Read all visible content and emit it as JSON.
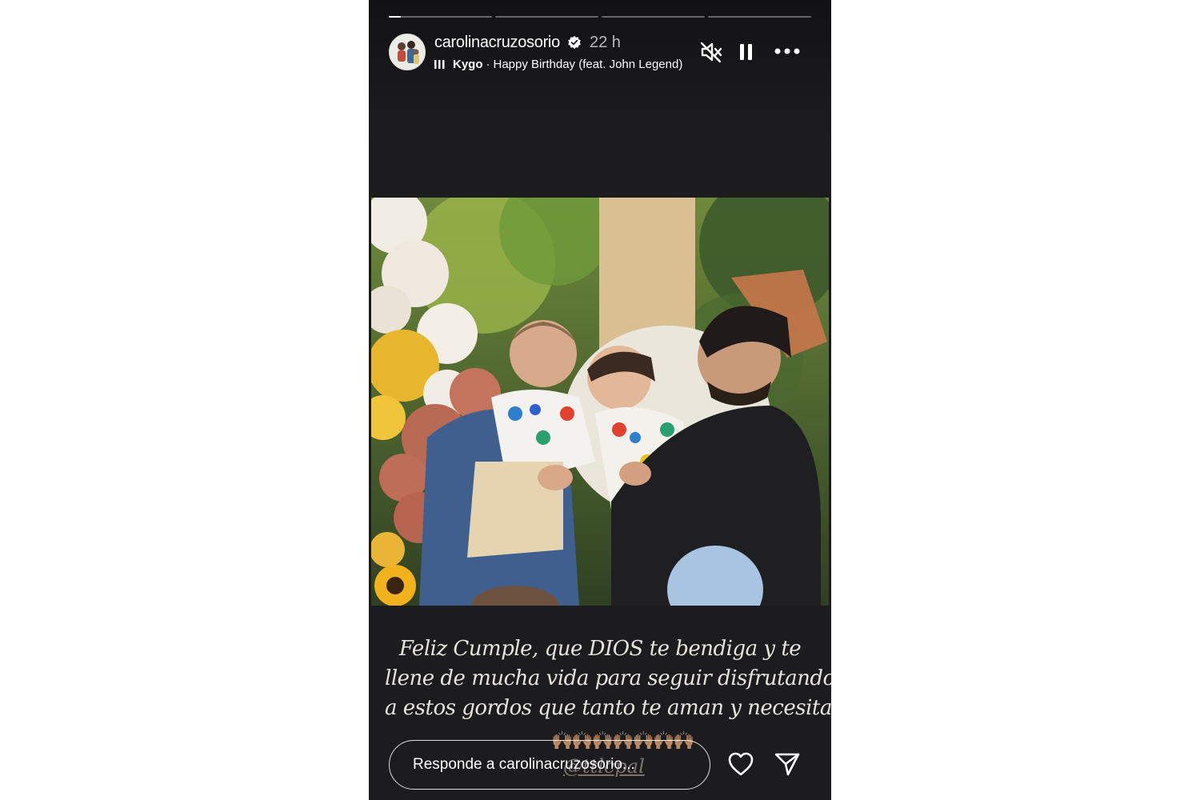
{
  "story": {
    "username": "carolinacruzosorio",
    "time": "22 h",
    "music": {
      "artist": "Kygo",
      "separator": "·",
      "song": "Happy Birthday (feat. John Legend)"
    },
    "progress": [
      0.12,
      0,
      0,
      0
    ],
    "icons": {
      "mute": "muted-speaker-icon",
      "pause": "pause-icon",
      "more": "more-options-icon",
      "verified": "verified-badge-icon",
      "like": "heart-icon",
      "share": "send-icon"
    },
    "caption_lines": [
      "Feliz Cumple, que DIOS te  bendiga y te",
      "llene de mucha vida para seguir disfrutando",
      "a estos gordos que tanto te aman y necesitan"
    ],
    "emoji": "🙌🏽🙌🏽🙌🏽🙌🏽🙌🏽🙌🏽🙌🏽",
    "mention": "@ttlcpal",
    "reply_placeholder": "Responde a carolinacruzosorio..."
  },
  "colors": {
    "background": "#1c1c1e",
    "text": "#ffffff",
    "caption": "#e6e3df"
  }
}
